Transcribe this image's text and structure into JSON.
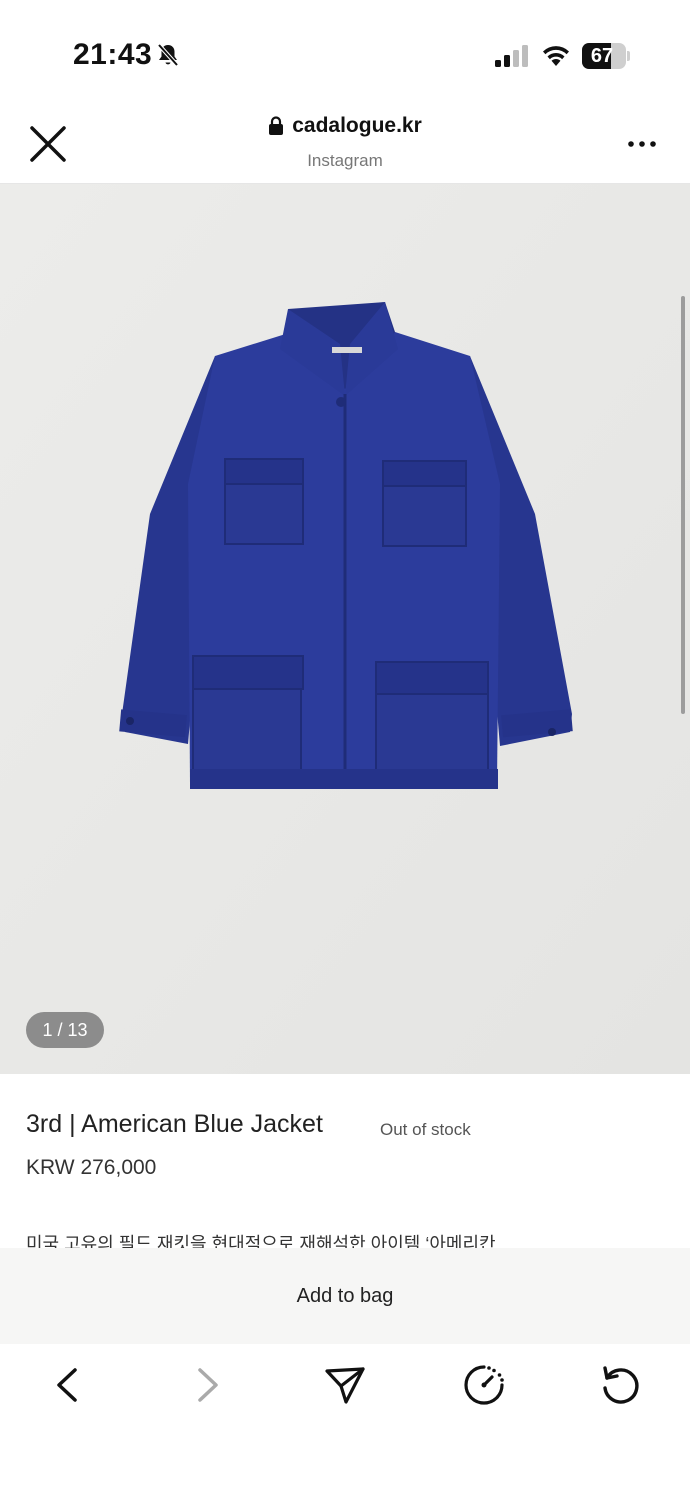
{
  "status_bar": {
    "time": "21:43",
    "battery": "67",
    "battery_level": 0.67,
    "icons": [
      "bell-slash-icon",
      "cellular-signal-icon",
      "wifi-icon",
      "battery-icon"
    ]
  },
  "browser": {
    "url": "cadalogue.kr",
    "subtitle": "Instagram",
    "icons": [
      "close-icon",
      "lock-icon",
      "more-dots-icon"
    ]
  },
  "gallery": {
    "counter": "1 / 13",
    "background_color": "#e9e9e7",
    "jacket_color": "#2a3a9a"
  },
  "product": {
    "title": "3rd | American Blue Jacket",
    "stock_status": "Out of stock",
    "price": "KRW 276,000",
    "description": "미국 고유의 필드 재킷을 현대적으로 재해석한 아이템 ‘아메리칸"
  },
  "cta": {
    "add_to_bag": "Add to bag"
  },
  "toolbar": {
    "icons": [
      "back-arrow-icon",
      "forward-arrow-icon",
      "share-icon",
      "speed-icon",
      "refresh-icon"
    ]
  }
}
